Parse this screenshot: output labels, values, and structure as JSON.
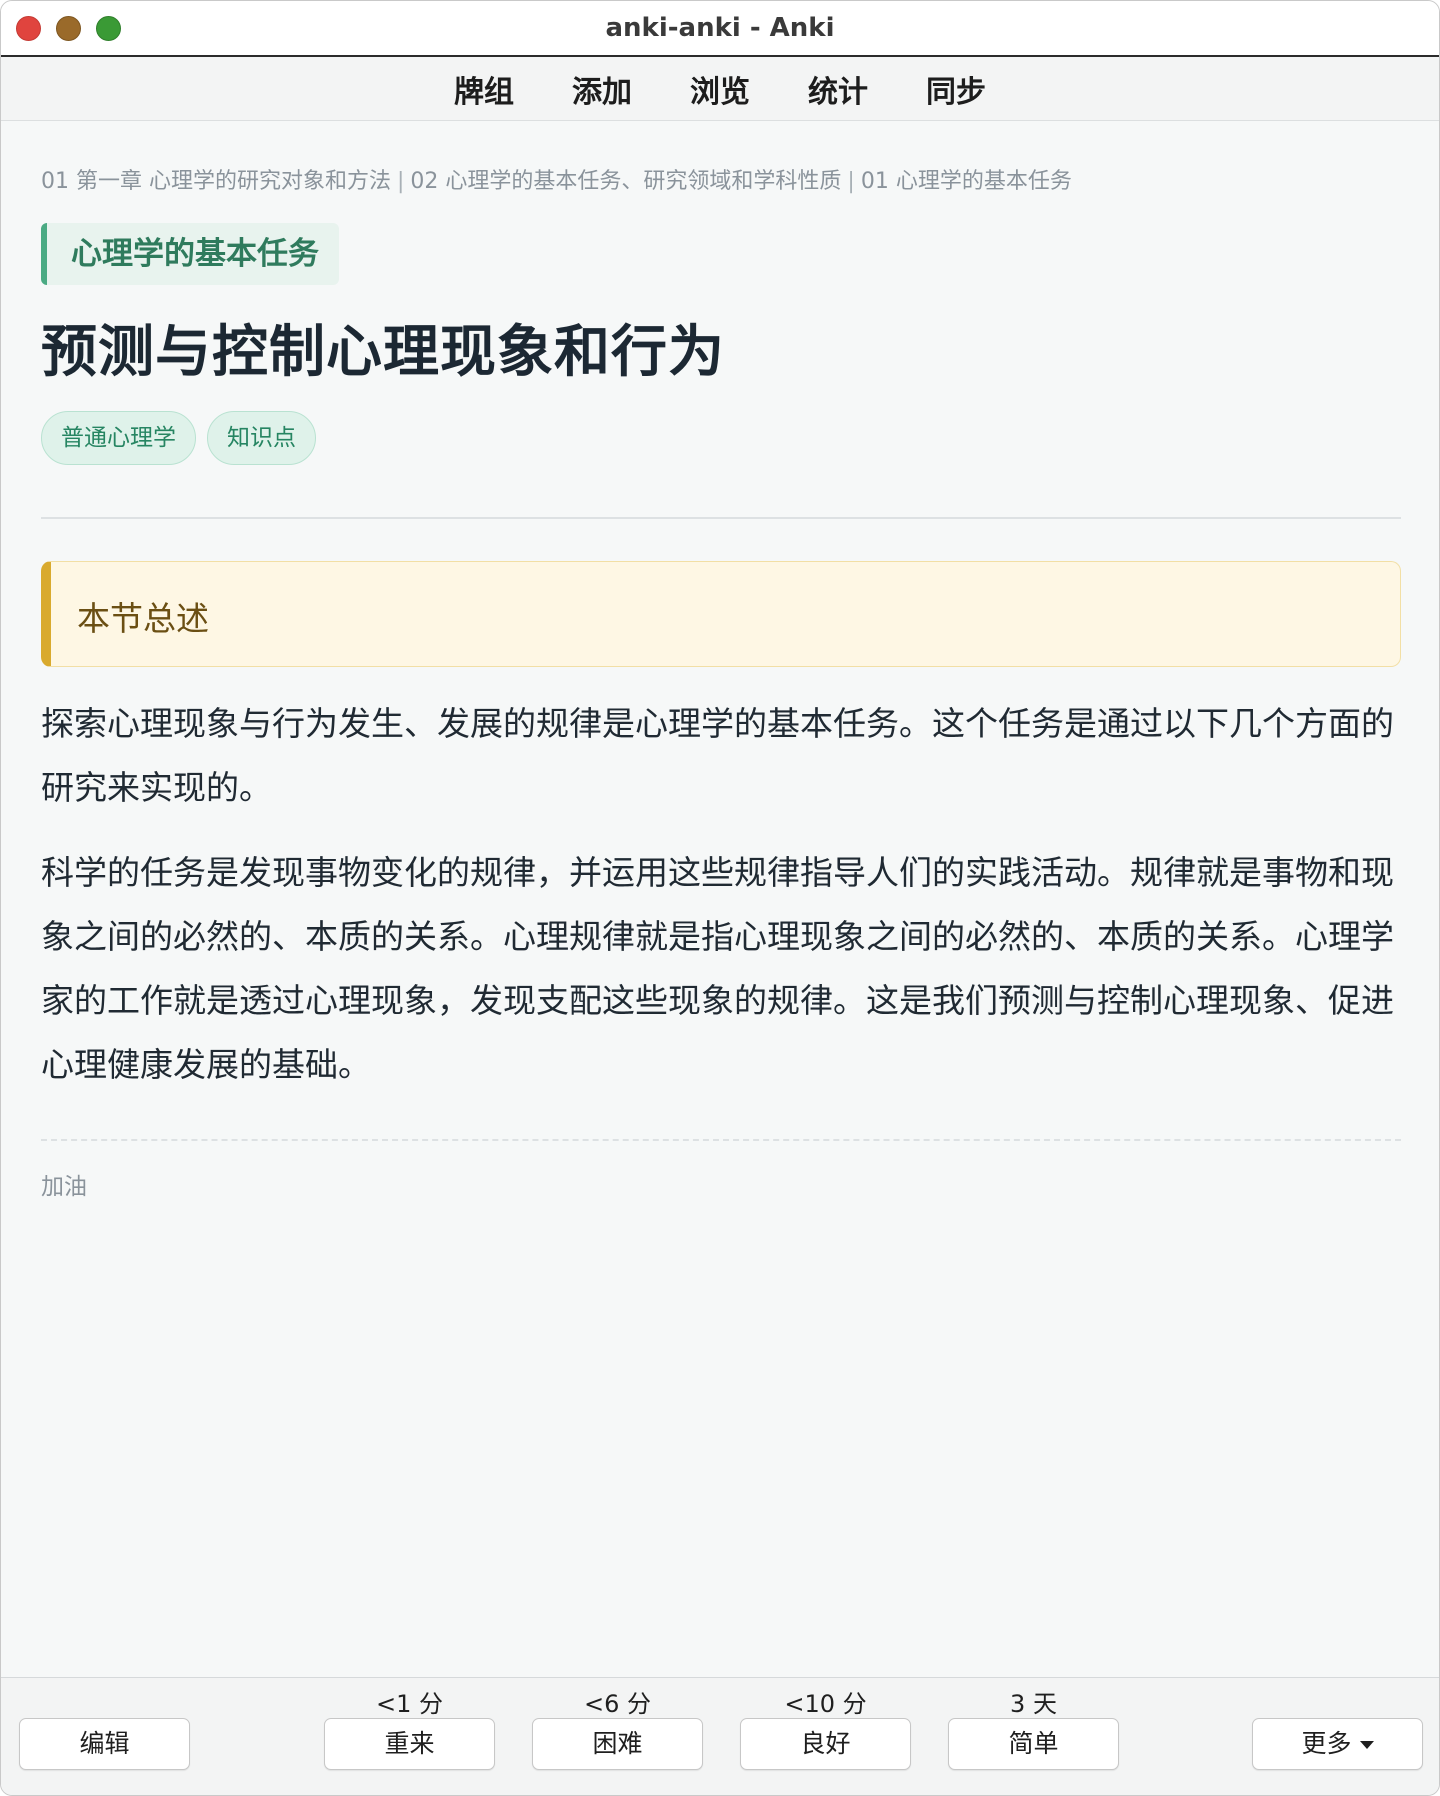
{
  "window": {
    "title": "anki-anki - Anki"
  },
  "nav": {
    "items": [
      "牌组",
      "添加",
      "浏览",
      "统计",
      "同步"
    ]
  },
  "card": {
    "breadcrumb": [
      "01 第一章 心理学的研究对象和方法",
      "02 心理学的基本任务、研究领域和学科性质",
      "01 心理学的基本任务"
    ],
    "breadcrumb_separator": "|",
    "section_tag": "心理学的基本任务",
    "title": "预测与控制心理现象和行为",
    "tags": [
      "普通心理学",
      "知识点"
    ],
    "summary_title": "本节总述",
    "paragraph1": "探索心理现象与行为发生、发展的规律是心理学的基本任务。这个任务是通过以下几个方面的研究来实现的。",
    "paragraph2": "科学的任务是发现事物变化的规律，并运用这些规律指导人们的实践活动。规律就是事物和现象之间的必然的、本质的关系。心理规律就是指心理现象之间的必然的、本质的关系。心理学家的工作就是透过心理现象，发现支配这些现象的规律。这是我们预测与控制心理现象、促进心理健康发展的基础。",
    "footnote": "加油"
  },
  "bottom": {
    "edit_label": "编辑",
    "more_label": "更多",
    "answers": [
      {
        "label": "重来",
        "interval": "<1 分"
      },
      {
        "label": "困难",
        "interval": "<6 分"
      },
      {
        "label": "良好",
        "interval": "<10 分"
      },
      {
        "label": "简单",
        "interval": "3 天"
      }
    ]
  },
  "colors": {
    "accent_green": "#4aaa83",
    "summary_border": "#d9aa2e",
    "close": "#e0443e",
    "minimize": "#9a6a2a",
    "zoom": "#3a9a35"
  }
}
